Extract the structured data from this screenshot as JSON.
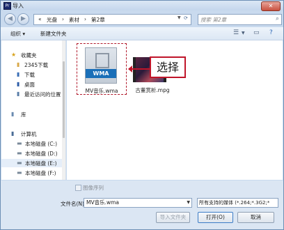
{
  "window": {
    "title": "导入",
    "app_icon": "Pr",
    "close_glyph": "✕"
  },
  "nav": {
    "back_glyph": "◀",
    "forward_glyph": "▶",
    "breadcrumb": {
      "root": "«",
      "sep": "›",
      "parts": [
        "光盘",
        "素材",
        "第2章"
      ]
    },
    "search_placeholder": "搜索 第2章",
    "search_icon": "search-icon"
  },
  "toolbar": {
    "organize": "组织 ▾",
    "new_folder": "新建文件夹"
  },
  "sidebar": {
    "items": [
      {
        "icon": "star-icon",
        "glyph": "★",
        "label": "收藏夹",
        "color": "#d7a21a"
      },
      {
        "icon": "folder-icon",
        "glyph": "▮",
        "label": "2345下载",
        "color": "#d9a94a"
      },
      {
        "icon": "download-icon",
        "glyph": "▮",
        "label": "下载",
        "color": "#3b6fb6"
      },
      {
        "icon": "desktop-icon",
        "glyph": "▮",
        "label": "桌面",
        "color": "#2e5ea8"
      },
      {
        "icon": "recent-icon",
        "glyph": "▮",
        "label": "最近访问的位置",
        "color": "#5a7ea8"
      },
      {
        "icon": "library-icon",
        "glyph": "▮",
        "label": "库",
        "color": "#6a8bb0"
      },
      {
        "icon": "computer-icon",
        "glyph": "▮",
        "label": "计算机",
        "color": "#4a6c96"
      },
      {
        "icon": "drive-icon",
        "glyph": "▬",
        "label": "本地磁盘 (C:)",
        "color": "#7a8a9a"
      },
      {
        "icon": "drive-icon",
        "glyph": "▬",
        "label": "本地磁盘 (D:)",
        "color": "#7a8a9a"
      },
      {
        "icon": "drive-icon",
        "glyph": "▬",
        "label": "本地磁盘 (E:)",
        "color": "#7a8a9a"
      },
      {
        "icon": "drive-icon",
        "glyph": "▬",
        "label": "本地磁盘 (F:)",
        "color": "#7a8a9a"
      }
    ]
  },
  "files": [
    {
      "name": "MV音乐.wma",
      "badge": "WMA"
    },
    {
      "name": "古董赏析.mpg"
    }
  ],
  "callout": {
    "text": "选择"
  },
  "bottom": {
    "sequence_label": "图像序列",
    "filename_label": "文件名(N):",
    "filename_value": "MV音乐.wma",
    "filter_value": "所有支持的媒体 (*.264;*.3G2;*",
    "import_folder": "导入文件夹",
    "open": "打开(O)",
    "cancel": "取消"
  },
  "colors": {
    "accent_red": "#c0152a",
    "wma_blue": "#1a6fb8"
  }
}
